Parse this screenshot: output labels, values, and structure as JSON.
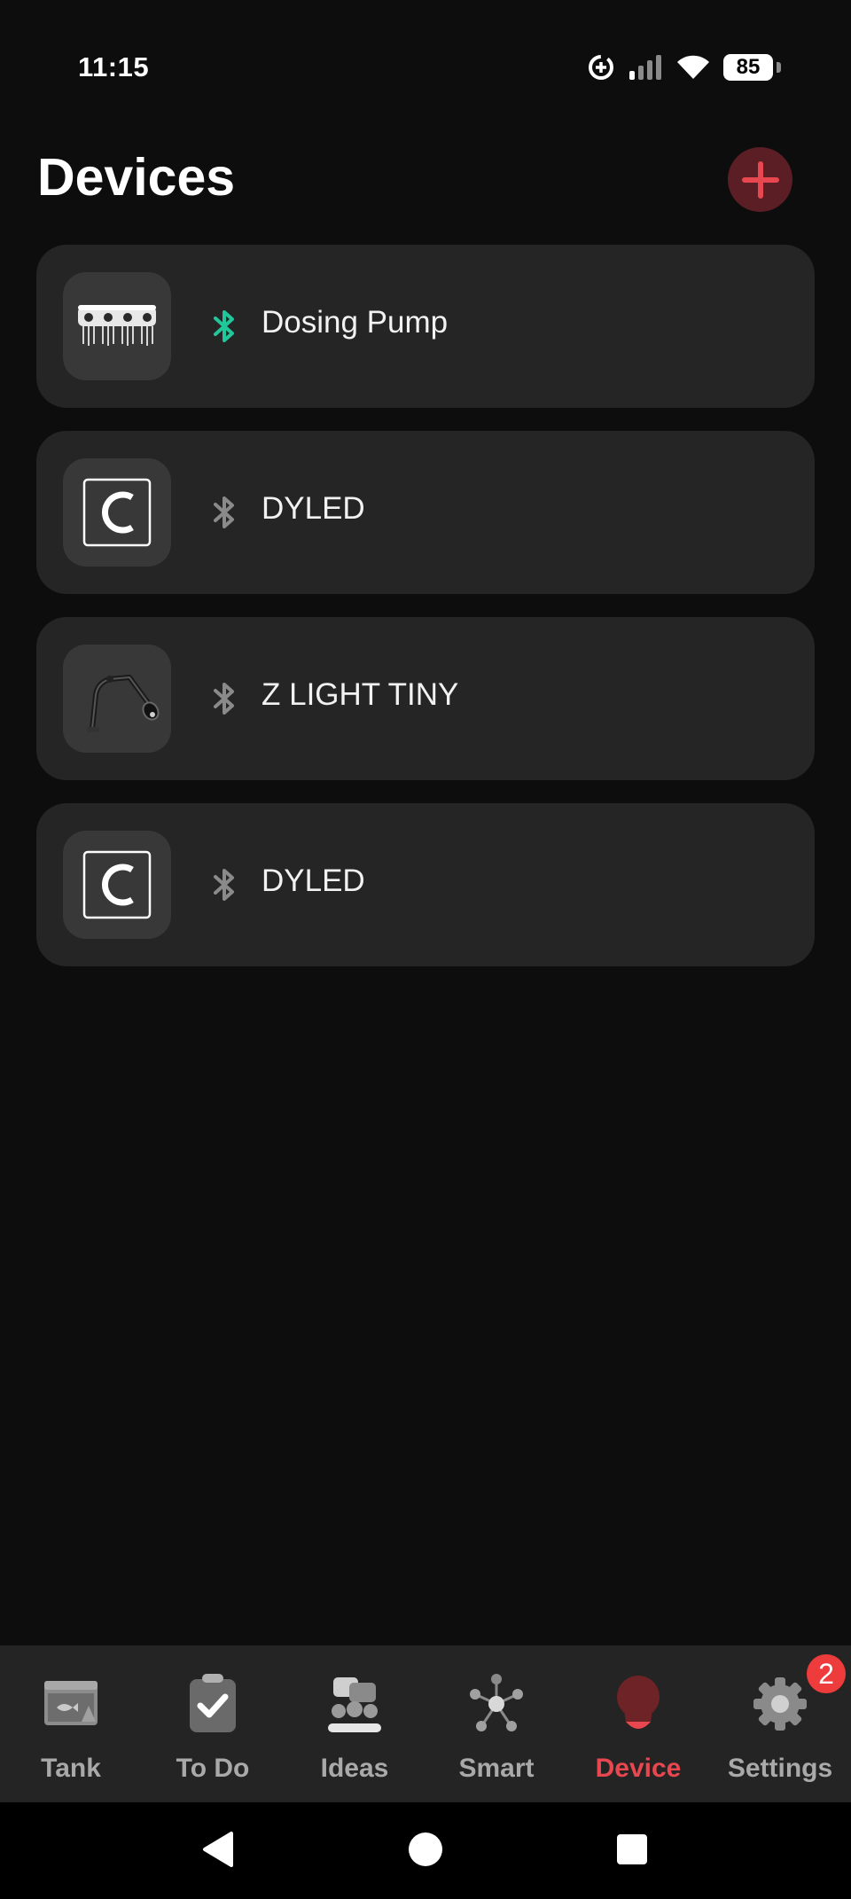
{
  "status_bar": {
    "time": "11:15",
    "battery": "85"
  },
  "header": {
    "title": "Devices",
    "add_icon": "plus-icon"
  },
  "colors": {
    "accent": "#e8474f",
    "bluetooth_connected": "#1fc79a",
    "bluetooth_disconnected": "#8a8a8a",
    "card_bg": "#252525",
    "page_bg": "#0d0d0d"
  },
  "devices": [
    {
      "name": "Dosing Pump",
      "thumbnail": "dosing-pump-image",
      "bluetooth": "connected"
    },
    {
      "name": "DYLED",
      "thumbnail": "dyled-logo",
      "bluetooth": "disconnected"
    },
    {
      "name": "Z LIGHT TINY",
      "thumbnail": "z-light-tiny-image",
      "bluetooth": "disconnected"
    },
    {
      "name": "DYLED",
      "thumbnail": "dyled-logo",
      "bluetooth": "disconnected"
    }
  ],
  "bottom_nav": {
    "items": [
      {
        "label": "Tank",
        "icon": "tank-icon"
      },
      {
        "label": "To Do",
        "icon": "clipboard-check-icon"
      },
      {
        "label": "Ideas",
        "icon": "ideas-icon"
      },
      {
        "label": "Smart",
        "icon": "network-icon"
      },
      {
        "label": "Device",
        "icon": "bulb-icon",
        "active": true
      },
      {
        "label": "Settings",
        "icon": "gear-icon",
        "badge": "2"
      }
    ]
  },
  "system_nav": {
    "back": "back-triangle-icon",
    "home": "home-circle-icon",
    "recents": "recents-square-icon"
  }
}
